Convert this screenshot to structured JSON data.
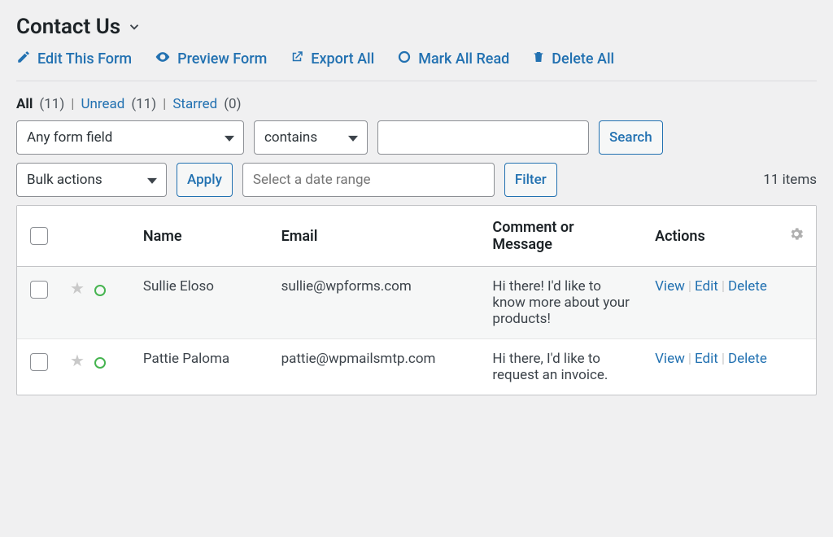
{
  "header": {
    "title": "Contact Us",
    "links": {
      "edit": "Edit This Form",
      "preview": "Preview Form",
      "export": "Export All",
      "mark_read": "Mark All Read",
      "delete_all": "Delete All"
    }
  },
  "filters": {
    "all_label": "All",
    "all_count": "(11)",
    "unread_label": "Unread",
    "unread_count": "(11)",
    "starred_label": "Starred",
    "starred_count": "(0)"
  },
  "search": {
    "field_select": "Any form field",
    "op_select": "contains",
    "value": "",
    "search_btn": "Search"
  },
  "bulk": {
    "bulk_select": "Bulk actions",
    "apply_btn": "Apply",
    "date_placeholder": "Select a date range",
    "filter_btn": "Filter",
    "items_count": "11 items"
  },
  "table": {
    "headers": {
      "name": "Name",
      "email": "Email",
      "comment": "Comment or Message",
      "actions": "Actions"
    },
    "actions": {
      "view": "View",
      "edit": "Edit",
      "delete": "Delete"
    },
    "rows": [
      {
        "name": "Sullie Eloso",
        "email": "sullie@wpforms.com",
        "msg": "Hi there! I'd like to know more about your products!"
      },
      {
        "name": "Pattie Paloma",
        "email": "pattie@wpmailsmtp.com",
        "msg": "Hi there, I'd like to request an invoice."
      }
    ]
  }
}
